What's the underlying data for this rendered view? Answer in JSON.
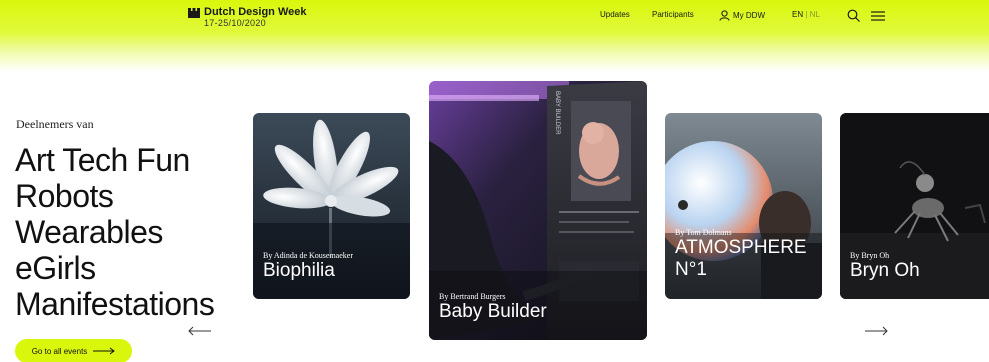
{
  "brand": {
    "name": "Dutch Design Week",
    "dates": "17-25/10/2020"
  },
  "nav": {
    "updates": "Updates",
    "participants": "Participants",
    "my_ddw": "My DDW",
    "lang_en": "EN",
    "lang_sep": "|",
    "lang_nl": "NL"
  },
  "intro": {
    "label": "Deelnemers van",
    "categories": [
      "Art Tech Fun",
      "Robots",
      "Wearables",
      "eGirls",
      "Manifestations"
    ]
  },
  "cta": {
    "label": "Go to all events"
  },
  "cards": [
    {
      "author": "By Adinda de Kousemaeker",
      "title": "Biophilia"
    },
    {
      "author": "By Bertrand Burgers",
      "title": "Baby Builder",
      "exhibit_label": "BABY BUILDER"
    },
    {
      "author": "By Tom Dolmans",
      "title_line1": "ATMOSPHERE",
      "title_line2": "N°1"
    },
    {
      "author": "By Bryn Oh",
      "title": "Bryn Oh"
    }
  ],
  "colors": {
    "accent": "#d9f70c",
    "text": "#111111"
  }
}
